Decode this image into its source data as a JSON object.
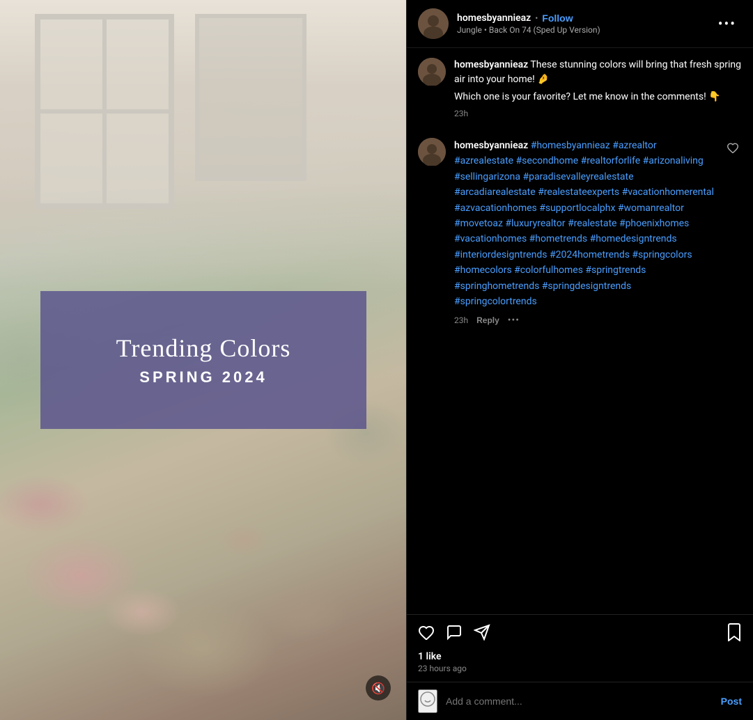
{
  "header": {
    "username": "homesbyannieaz",
    "follow_label": "Follow",
    "dot": "•",
    "song": "Jungle • Back On 74 (Sped Up Version)",
    "more_icon": "•••"
  },
  "left_panel": {
    "trending_title": "Trending Colors",
    "trending_subtitle": "SPRING 2024",
    "mute_icon": "🔇"
  },
  "comments": [
    {
      "id": "main-comment",
      "username": "homesbyannieaz",
      "text": "These stunning colors will bring that fresh spring air into your home! 🤌",
      "extra_text": "Which one is your favorite? Let me know in the comments! 👇",
      "time": "23h",
      "has_like": false
    },
    {
      "id": "hashtag-comment",
      "username": "homesbyannieaz",
      "hashtags": "#homesbyannieaz #azrealtor #azrealestate #secondhome #realtorforlife #arizonaliving #sellingarizona #paradisevalleyrealestate #arcadiarealestate #realestateexperts #vacationhomerental #azvacationhomes #supportlocalphx #womanrealtor #movetoaz #luxuryrealtor #realestate #phoenixhomes #vacationhomes #hometrends #homedesigntrends #interiordesigntrends #2024hometrends #springcolors #homecolors #colorfulhomes #springtrends #springhometrends #springdesigntrends #springcolortrends",
      "time": "23h",
      "reply_label": "Reply",
      "more_icon": "•••",
      "has_like": true
    }
  ],
  "action_bar": {
    "like_icon": "♡",
    "comment_icon": "○",
    "share_icon": "➤",
    "bookmark_icon": "🔖",
    "likes_count": "1 like",
    "post_time": "23 hours ago"
  },
  "add_comment": {
    "placeholder": "Add a comment...",
    "post_label": "Post",
    "emoji": "😊"
  }
}
